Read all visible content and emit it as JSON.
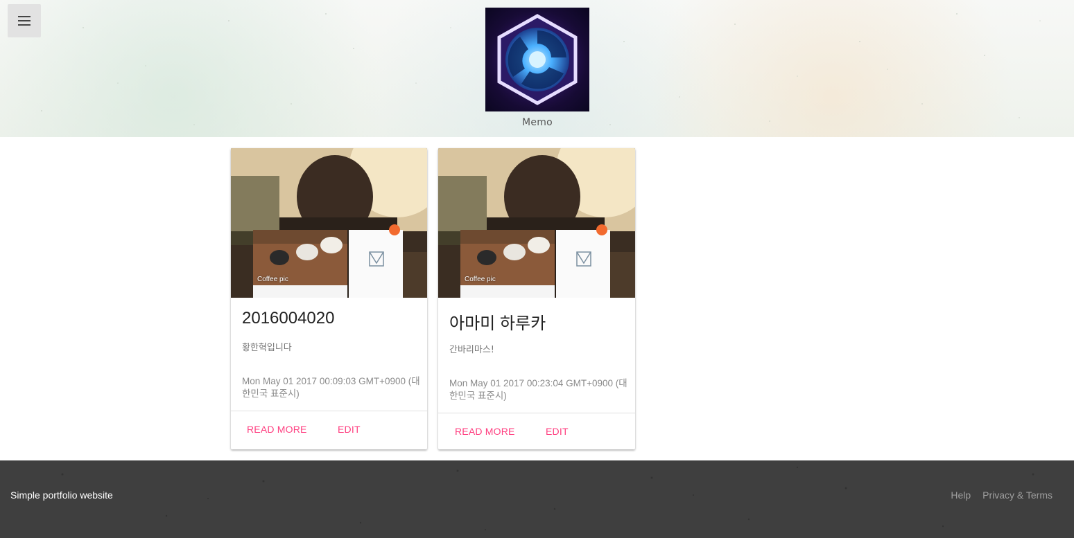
{
  "header": {
    "menu_icon": "hamburger-menu-icon",
    "logo": "heroes-hexagon-logo",
    "title": "Memo"
  },
  "cards": [
    {
      "image_caption": "Coffee pic",
      "title": "2016004020",
      "text": "황한혁입니다",
      "date": "Mon May 01 2017 00:09:03 GMT+0900 (대한민국 표준시)",
      "read_more_label": "READ MORE",
      "edit_label": "EDIT"
    },
    {
      "image_caption": "Coffee pic",
      "title": "아마미 하루카",
      "text": "간바리마스!",
      "date": "Mon May 01 2017 00:23:04 GMT+0900 (대한민국 표준시)",
      "read_more_label": "READ MORE",
      "edit_label": "EDIT"
    }
  ],
  "footer": {
    "title": "Simple portfolio website",
    "links": [
      "Help",
      "Privacy & Terms"
    ]
  },
  "colors": {
    "accent": "#ff4081",
    "footer_bg": "#3f3f3f",
    "menu_bg": "#e2e2e2"
  }
}
